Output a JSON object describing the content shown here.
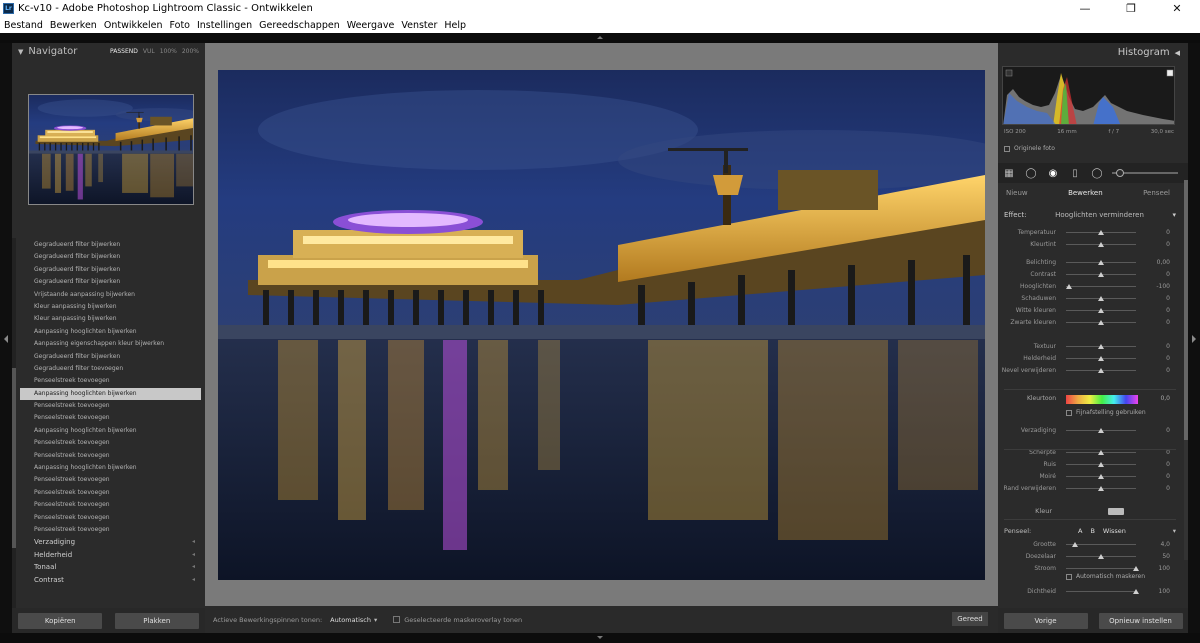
{
  "window": {
    "title": "Kc-v10 - Adobe Photoshop Lightroom Classic - Ontwikkelen",
    "icon": "lr-app-icon",
    "controls": [
      "minimize",
      "maximize",
      "close"
    ]
  },
  "menu": [
    "Bestand",
    "Bewerken",
    "Ontwikkelen",
    "Foto",
    "Instellingen",
    "Gereedschappen",
    "Weergave",
    "Venster",
    "Help"
  ],
  "navigator": {
    "title": "Navigator",
    "zoom_levels": [
      "PASSEND",
      "VUL",
      "100%",
      "200%"
    ],
    "active_zoom": "PASSEND"
  },
  "history": [
    "Gegradueerd filter bijwerken",
    "Gegradueerd filter bijwerken",
    "Gegradueerd filter bijwerken",
    "Gegradueerd filter bijwerken",
    "Vrijstaande aanpassing bijwerken",
    "Kleur aanpassing bijwerken",
    "Kleur aanpassing bijwerken",
    "Aanpassing hooglichten bijwerken",
    "Aanpassing eigenschappen kleur bijwerken",
    "Gegradueerd filter bijwerken",
    "Gegradueerd filter toevoegen",
    "Penseelstreek toevoegen",
    "Aanpassing hooglichten bijwerken",
    "Penseelstreek toevoegen",
    "Penseelstreek toevoegen",
    "Aanpassing hooglichten bijwerken",
    "Penseelstreek toevoegen",
    "Penseelstreek toevoegen",
    "Aanpassing hooglichten bijwerken",
    "Penseelstreek toevoegen",
    "Penseelstreek toevoegen",
    "Penseelstreek toevoegen",
    "Penseelstreek toevoegen",
    "Penseelstreek toevoegen"
  ],
  "history_selected_index": 12,
  "left_sections": [
    "Verzadiging",
    "Helderheid",
    "Tonaal",
    "Contrast"
  ],
  "left_buttons": {
    "copy": "Kopiëren",
    "paste": "Plakken"
  },
  "toolbar": {
    "show_overlay_label": "Actieve Bewerkingspinnen tonen:",
    "show_overlay_value": "Automatisch",
    "selected_mask_label": "Geselecteerde maskeroverlay tonen",
    "done": "Gereed"
  },
  "right_panel": {
    "histogram_title": "Histogram",
    "histogram_stats": [
      "ISO 200",
      "16 mm",
      "f / 7",
      "30,0 sec"
    ],
    "original_photo": "Originele foto",
    "mask_tabs": [
      "Nieuw",
      "Bewerken",
      "Penseel"
    ],
    "effect_label": "Effect:",
    "effect_preset": "Hooglichten verminderen",
    "adjustments_a": [
      {
        "label": "Temperatuur",
        "value": "0"
      },
      {
        "label": "Kleurtint",
        "value": "0"
      }
    ],
    "adjustments_b": [
      {
        "label": "Belichting",
        "value": "0,00"
      },
      {
        "label": "Contrast",
        "value": "0"
      },
      {
        "label": "Hooglichten",
        "value": "-100"
      },
      {
        "label": "Schaduwen",
        "value": "0"
      },
      {
        "label": "Witte kleuren",
        "value": "0"
      },
      {
        "label": "Zwarte kleuren",
        "value": "0"
      }
    ],
    "adjustments_c": [
      {
        "label": "Textuur",
        "value": "0"
      },
      {
        "label": "Helderheid",
        "value": "0"
      },
      {
        "label": "Nevel verwijderen",
        "value": "0"
      }
    ],
    "color_label": "Kleurtoon",
    "color_value": "0,0",
    "auto_label": "Fijnafstelling gebruiken",
    "saturation": {
      "label": "Verzadiging",
      "value": "0"
    },
    "adjustments_d": [
      {
        "label": "Scherpte",
        "value": "0"
      },
      {
        "label": "Ruis",
        "value": "0"
      },
      {
        "label": "Moiré",
        "value": "0"
      },
      {
        "label": "Rand verwijderen",
        "value": "0"
      }
    ],
    "color_row": "Kleur",
    "brush_title": "Penseel:",
    "brush_options": [
      "A",
      "B",
      "Wissen"
    ],
    "brush_sliders": [
      {
        "label": "Grootte",
        "value": "4,0"
      },
      {
        "label": "Doezelaar",
        "value": "50"
      },
      {
        "label": "Stroom",
        "value": "100"
      }
    ],
    "auto_mask": "Automatisch maskeren",
    "density": {
      "label": "Dichtheid",
      "value": "100"
    },
    "buttons": {
      "previous": "Vorige",
      "reset": "Opnieuw instellen"
    }
  },
  "colors": {
    "panel_bg": "#2b2b2b",
    "center_bg": "#7a7a7a",
    "selected_row": "#c8c8c8"
  }
}
